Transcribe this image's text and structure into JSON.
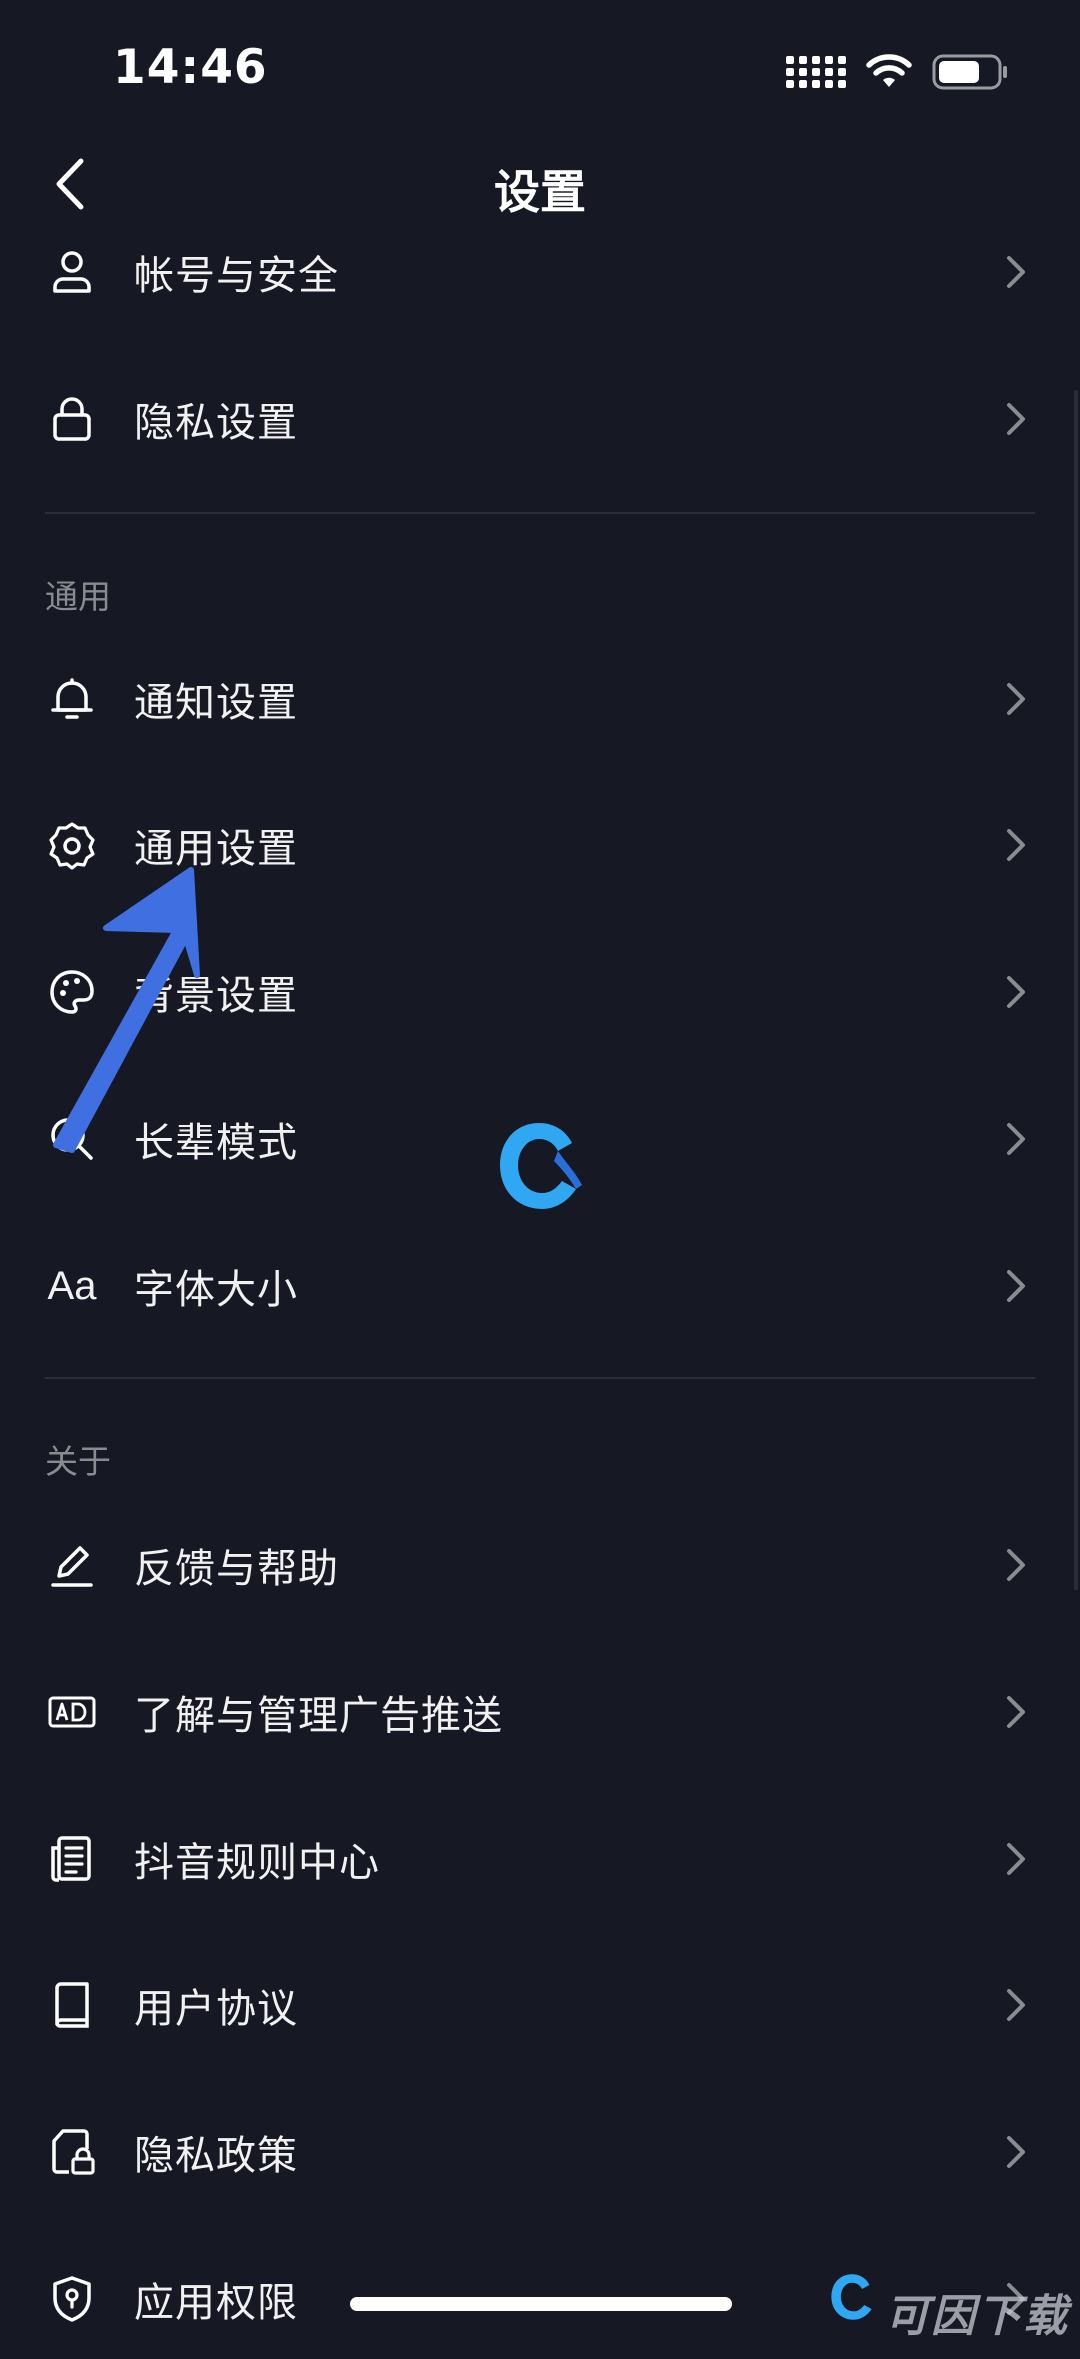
{
  "status": {
    "time": "14:46"
  },
  "nav": {
    "title": "设置"
  },
  "sections": {
    "general": "通用",
    "about": "关于"
  },
  "items": {
    "account": "帐号与安全",
    "privacy": "隐私设置",
    "notification": "通知设置",
    "general_settings": "通用设置",
    "background": "背景设置",
    "elder_mode": "长辈模式",
    "font_size": "字体大小",
    "font_size_icon_text": "Aa",
    "feedback": "反馈与帮助",
    "ads": "了解与管理广告推送",
    "rules": "抖音规则中心",
    "user_agreement": "用户协议",
    "privacy_policy": "隐私政策",
    "app_permissions": "应用权限"
  },
  "watermark": {
    "text": "可因下载"
  },
  "colors": {
    "background": "#161823",
    "text": "#ffffff",
    "section_text": "#8a8b91",
    "divider": "#2b2d37",
    "annotation_arrow": "#3f6fe0"
  },
  "icons": [
    "chevron-left-icon",
    "person-icon",
    "lock-icon",
    "bell-icon",
    "gear-icon",
    "palette-icon",
    "magnifier-icon",
    "font-size-icon",
    "pencil-icon",
    "ad-icon",
    "document-list-icon",
    "book-icon",
    "lock-file-icon",
    "shield-icon",
    "chevron-right-icon"
  ]
}
